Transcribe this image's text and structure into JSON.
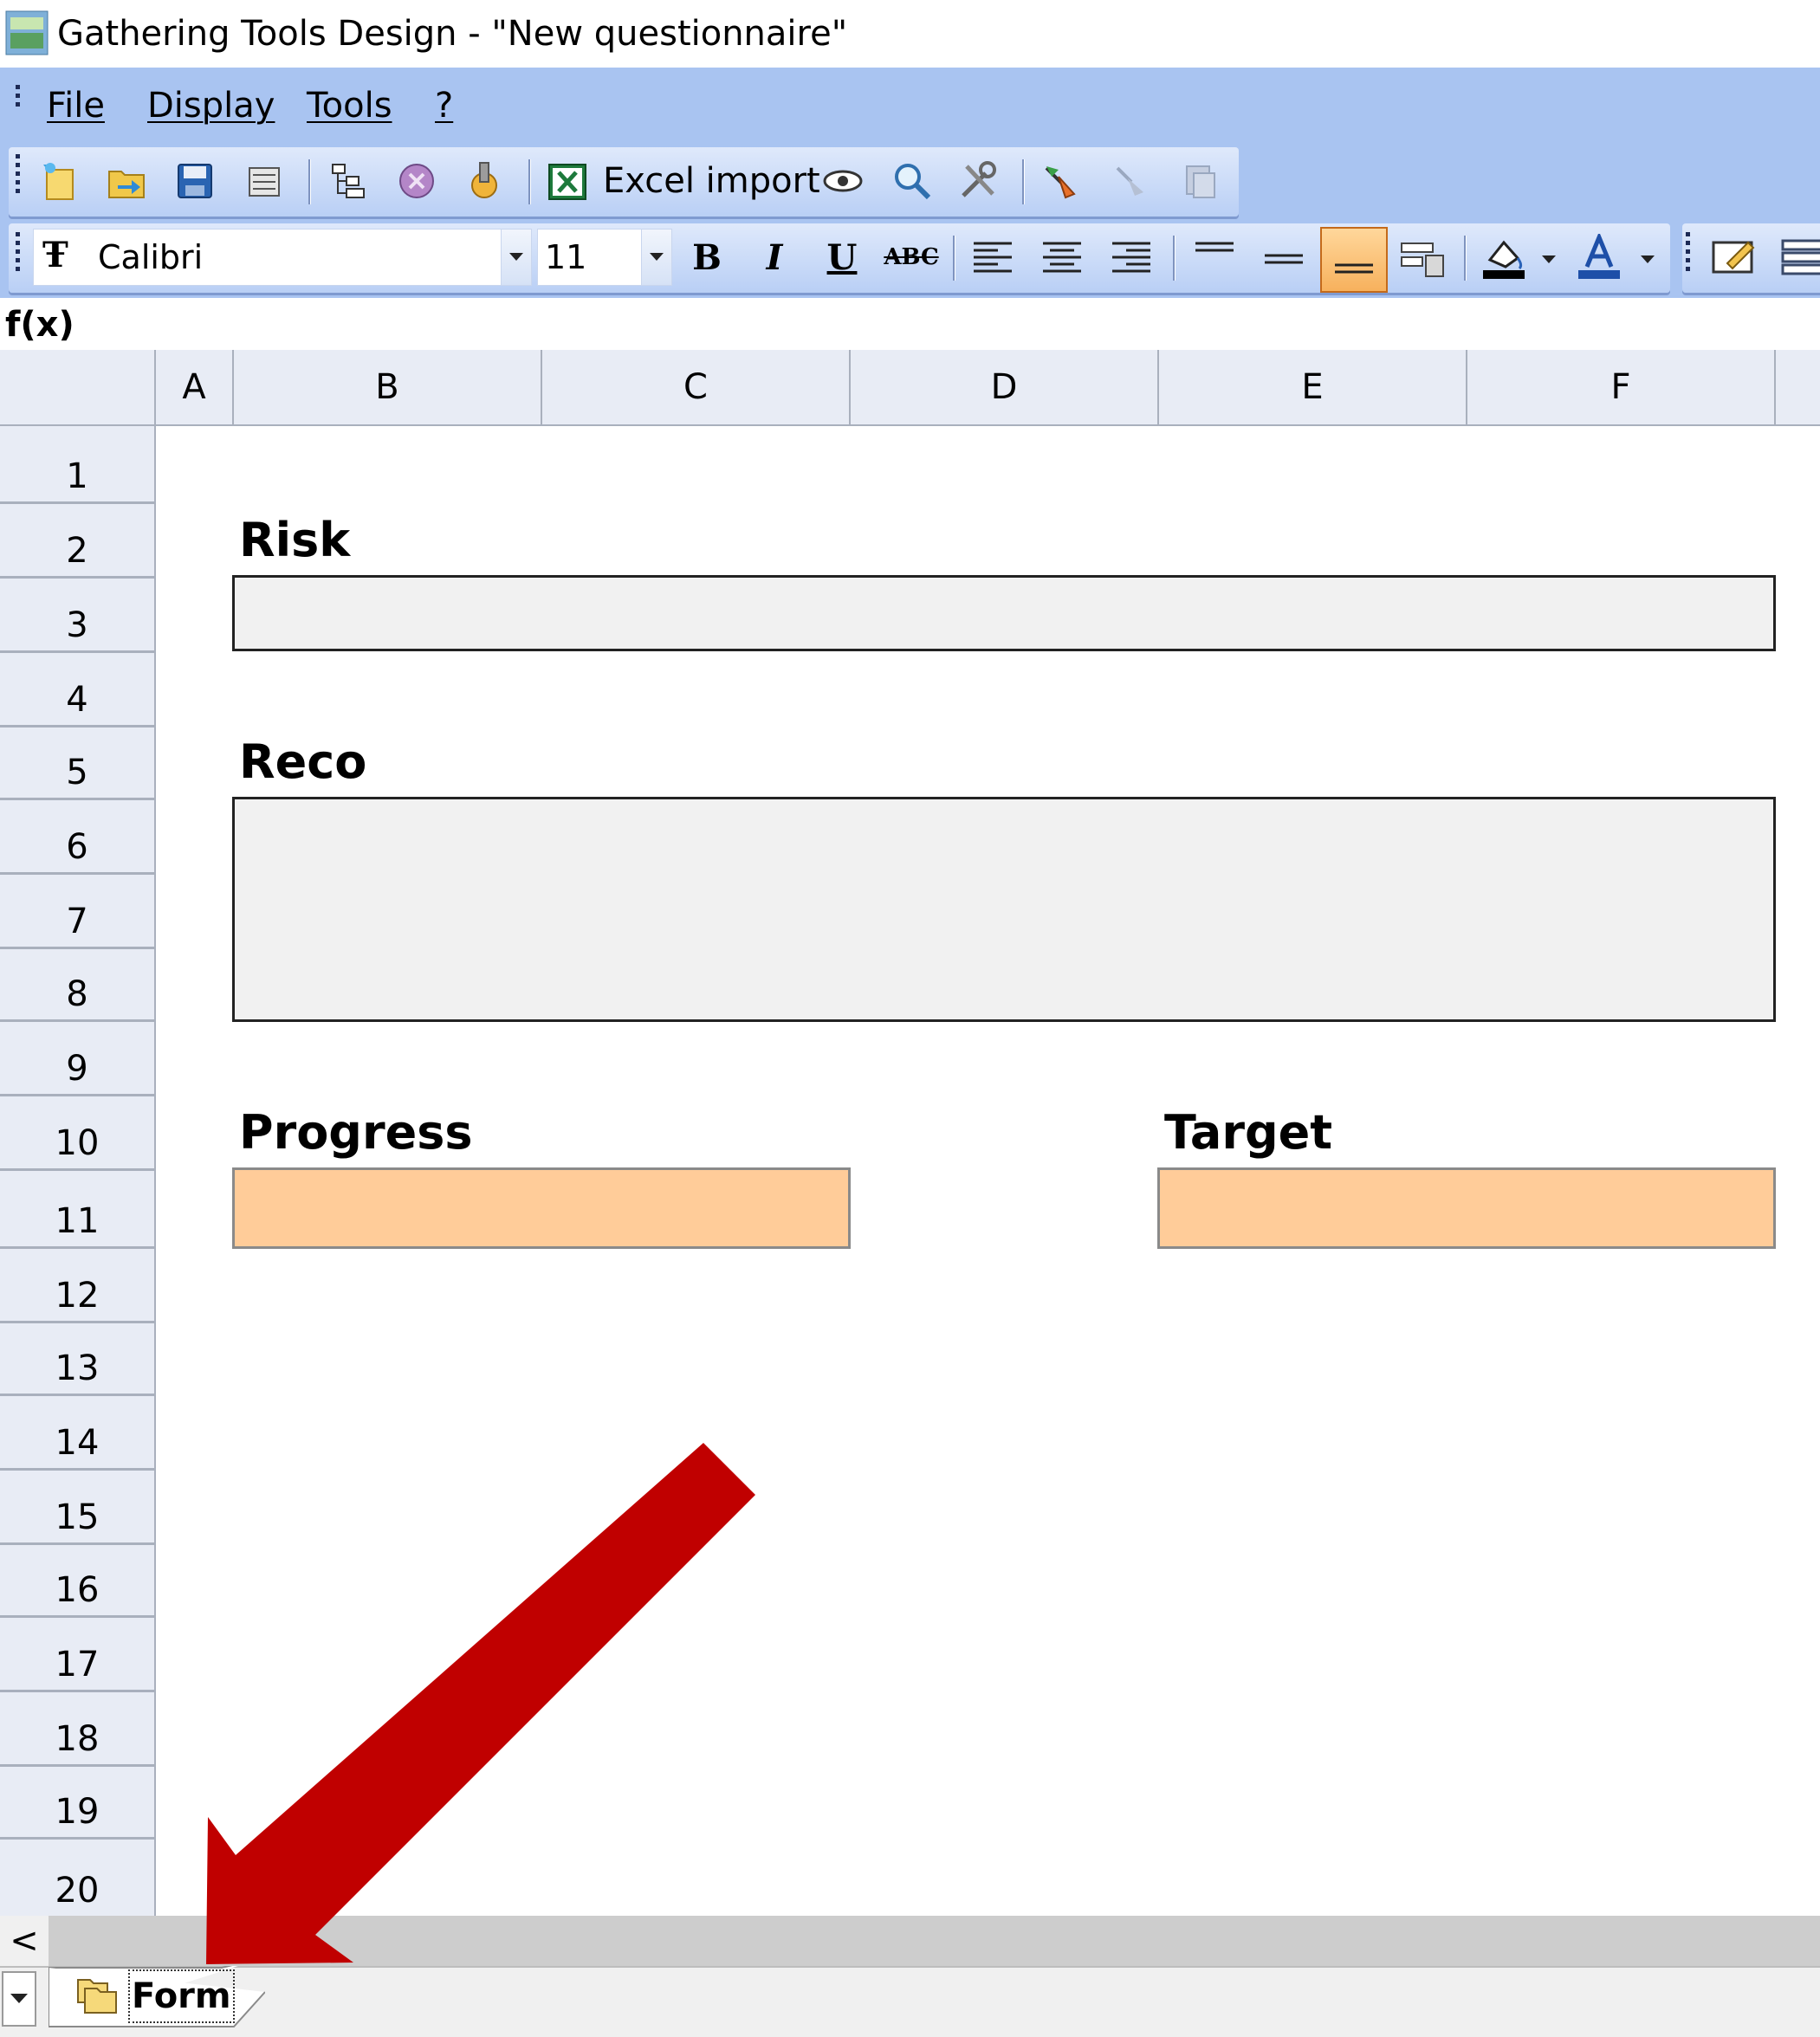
{
  "window": {
    "title": "Gathering Tools Design - \"New questionnaire\""
  },
  "menu": {
    "items": [
      "File",
      "Display",
      "Tools",
      "?"
    ]
  },
  "toolbar": {
    "excel_import_label": "Excel import"
  },
  "format_bar": {
    "font": "Calibri",
    "size": "11",
    "bold": "B",
    "italic": "I",
    "underline": "U",
    "strike": "ABC"
  },
  "formula_bar": {
    "label": "f(x)",
    "value": ""
  },
  "grid": {
    "columns": [
      "A",
      "B",
      "C",
      "D",
      "E",
      "F"
    ],
    "rows": [
      "1",
      "2",
      "3",
      "4",
      "5",
      "6",
      "7",
      "8",
      "9",
      "10",
      "11",
      "12",
      "13",
      "14",
      "15",
      "16",
      "17",
      "18",
      "19",
      "20"
    ]
  },
  "form": {
    "risk_label": "Risk",
    "reco_label": "Reco",
    "progress_label": "Progress",
    "target_label": "Target"
  },
  "sheet_tabs": {
    "active": "Form"
  },
  "colors": {
    "menu_bg": "#a9c4f1",
    "field_gray": "#f1f1f1",
    "field_orange": "#ffcc99",
    "annotation_arrow": "#c00000"
  },
  "scroll": {
    "left_arrow": "<"
  }
}
